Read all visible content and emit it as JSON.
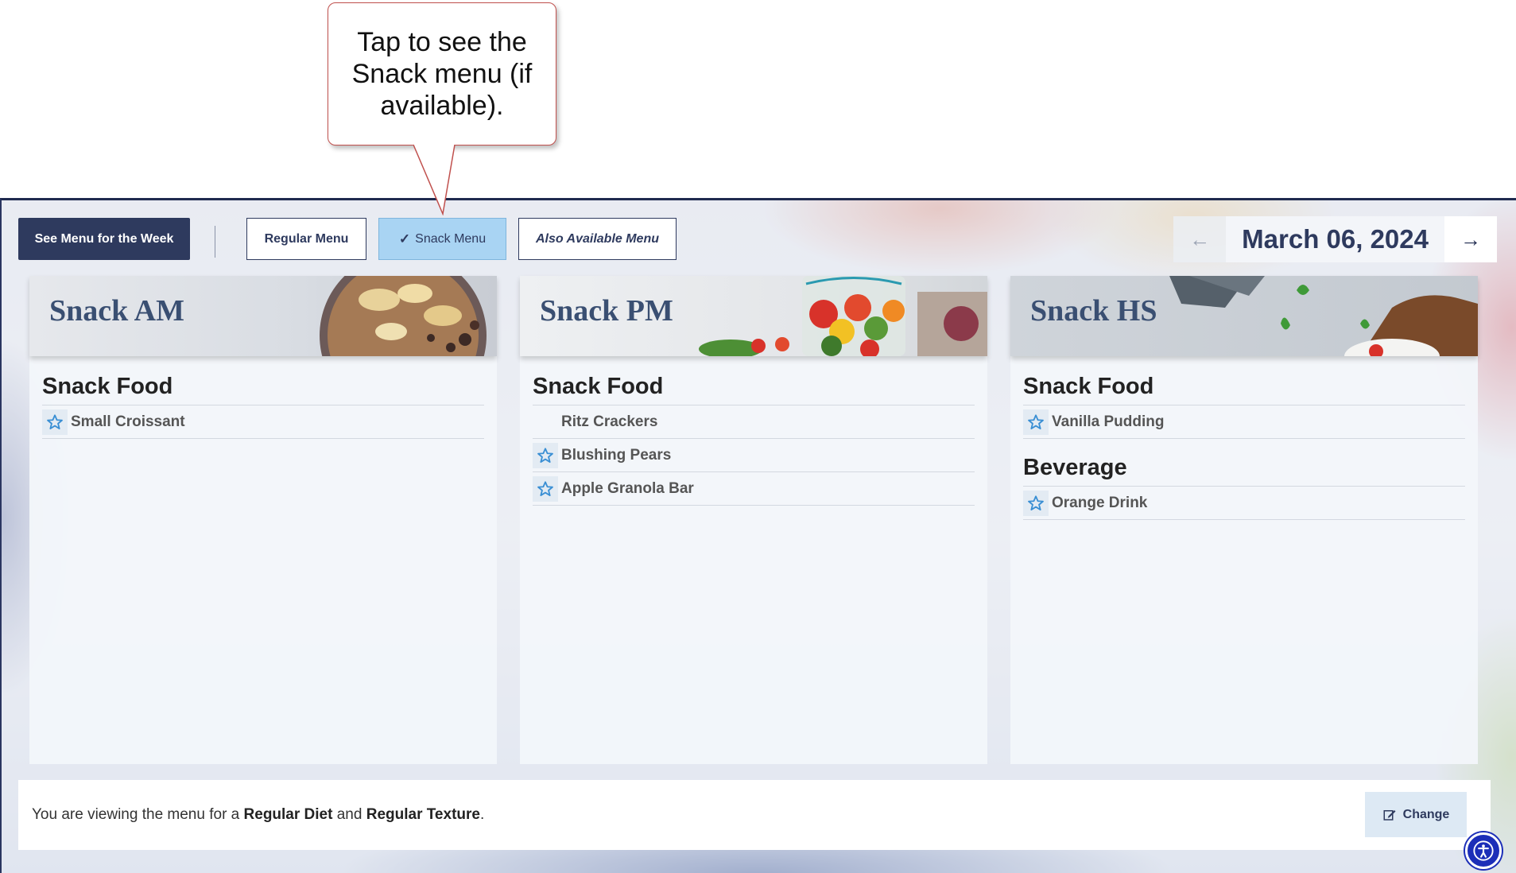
{
  "callout": {
    "text": "Tap to see the Snack menu (if available)."
  },
  "toolbar": {
    "week_button": "See Menu for the Week",
    "regular_button": "Regular Menu",
    "snack_button": "Snack Menu",
    "also_button": "Also Available Menu",
    "date": "March 06, 2024",
    "prev_icon": "arrow-left-icon",
    "next_icon": "arrow-right-icon"
  },
  "cards": [
    {
      "title": "Snack AM",
      "sections": [
        {
          "category": "Snack Food",
          "items": [
            {
              "name": "Small Croissant",
              "favorite_icon": true
            }
          ]
        }
      ]
    },
    {
      "title": "Snack PM",
      "sections": [
        {
          "category": "Snack Food",
          "items": [
            {
              "name": "Ritz Crackers",
              "favorite_icon": false
            },
            {
              "name": "Blushing Pears",
              "favorite_icon": true
            },
            {
              "name": "Apple Granola Bar",
              "favorite_icon": true
            }
          ]
        }
      ]
    },
    {
      "title": "Snack HS",
      "sections": [
        {
          "category": "Snack Food",
          "items": [
            {
              "name": "Vanilla Pudding",
              "favorite_icon": true
            }
          ]
        },
        {
          "category": "Beverage",
          "items": [
            {
              "name": "Orange Drink",
              "favorite_icon": true
            }
          ]
        }
      ]
    }
  ],
  "footer": {
    "prefix": "You are viewing the menu for a ",
    "diet": "Regular Diet",
    "middle": " and ",
    "texture": "Regular Texture",
    "suffix": ".",
    "change_button": "Change"
  },
  "colors": {
    "primary": "#2e3a5e",
    "selected": "#a9d4f3",
    "star": "#3a8fd4",
    "callout_border": "#c0504d"
  }
}
